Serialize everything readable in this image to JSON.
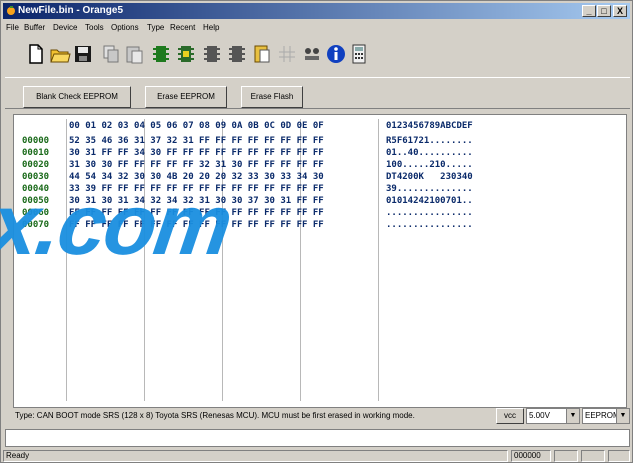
{
  "window": {
    "title": "NewFile.bin - Orange5"
  },
  "titlebar_buttons": [
    "_",
    "□",
    "X"
  ],
  "menu": [
    "File",
    "Buffer",
    "Device",
    "Tools",
    "Options",
    "Type",
    "Recent",
    "Help"
  ],
  "toolbar_icons": [
    "new-file-icon",
    "open-folder-icon",
    "save-icon",
    "copy-icon",
    "paste-icon",
    "chip-green-icon",
    "chip-yellow-icon",
    "chip-dark-icon",
    "chip-dark-icon-2",
    "clipboard-icon",
    "grid-icon",
    "connect-icon",
    "info-icon",
    "calculator-icon"
  ],
  "actions": {
    "blank_check": "Blank Check EEPROM",
    "erase_eeprom": "Erase EEPROM",
    "erase_flash": "Erase Flash"
  },
  "hex": {
    "header": "00 01 02 03 04 05 06 07 08 09 0A 0B 0C 0D 0E 0F",
    "ascii_header": "0123456789ABCDEF",
    "rows": [
      {
        "addr": "00000",
        "bytes": "52 35 46 36 31 37 32 31 FF FF FF FF FF FF FF FF",
        "ascii": "R5F61721........"
      },
      {
        "addr": "00010",
        "bytes": "30 31 FF FF 34 30 FF FF FF FF FF FF FF FF FF FF",
        "ascii": "01..40.........."
      },
      {
        "addr": "00020",
        "bytes": "31 30 30 FF FF FF FF FF 32 31 30 FF FF FF FF FF",
        "ascii": "100.....210....."
      },
      {
        "addr": "00030",
        "bytes": "44 54 34 32 30 30 4B 20 20 20 32 33 30 33 34 30",
        "ascii": "DT4200K   230340"
      },
      {
        "addr": "00040",
        "bytes": "33 39 FF FF FF FF FF FF FF FF FF FF FF FF FF FF",
        "ascii": "39.............."
      },
      {
        "addr": "00050",
        "bytes": "30 31 30 31 34 32 34 32 31 30 30 37 30 31 FF FF",
        "ascii": "01014242100701.."
      },
      {
        "addr": "00060",
        "bytes": "FF FF FF FF FF FF FF FF FF FF FF FF FF FF FF FF",
        "ascii": "................"
      },
      {
        "addr": "00070",
        "bytes": "FF FF FF FF FF FF FF FF FF FF FF FF FF FF FF FF",
        "ascii": "................"
      }
    ]
  },
  "watermark": "x.com",
  "info": {
    "type_text": "Type: CAN BOOT mode SRS (128 x 8)   Toyota SRS (Renesas MCU). MCU must be first erased in working mode.",
    "vcc_label": "vcc",
    "voltage": "5.00V",
    "memory": "EEPROM_II"
  },
  "status": {
    "text": "Ready",
    "address": "000000"
  },
  "colors": {
    "title_start": "#0a246a",
    "title_end": "#a6caf0",
    "hex_text": "#0a2a6a",
    "addr_text": "#1a6a1a",
    "watermark": "#1a8fe0"
  }
}
